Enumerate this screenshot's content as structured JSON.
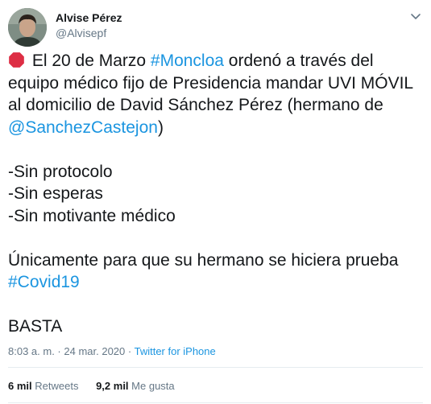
{
  "author": {
    "name": "Alvise Pérez",
    "handle": "@Alvisepf"
  },
  "tweet": {
    "line1_text": " El 20 de Marzo ",
    "line1_hashtag": "#Moncloa",
    "line1_rest": " ordenó a través del",
    "line2": "equipo médico fijo de Presidencia mandar UVI MÓVIL",
    "line3": "al domicilio de David Sánchez Pérez (hermano de",
    "line4_mention": "@SanchezCastejon",
    "line4_rest": ")",
    "item1": "-Sin protocolo",
    "item2": "-Sin esperas",
    "item3": "-Sin motivante médico",
    "line8": "Únicamente para que su hermano se hiciera prueba",
    "line9_hashtag": "#Covid19",
    "line10": "BASTA"
  },
  "meta": {
    "time": "8:03 a. m.",
    "separator": " · ",
    "date": "24 mar. 2020",
    "separator2": " · ",
    "source": "Twitter for iPhone"
  },
  "stats": {
    "retweets_count": "6 mil",
    "retweets_label": "Retweets",
    "likes_count": "9,2 mil",
    "likes_label": "Me gusta"
  },
  "icons": {
    "emoji": "stop-sign-emoji",
    "menu": "chevron-down-icon"
  },
  "colors": {
    "link": "#1b95e0",
    "muted": "#657786",
    "text": "#14171a"
  }
}
